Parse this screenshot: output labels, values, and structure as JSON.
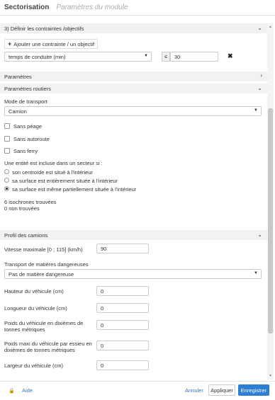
{
  "header": {
    "title": "Sectorisation",
    "subtitle": "Paramètres du module"
  },
  "constraints": {
    "section_title": "3) Définir les contraintes /objectifs",
    "add_button": "Ajouter une contrainte / un objectif",
    "constraint_select": "temps de conduite (min)",
    "operator": "≤",
    "value": "30"
  },
  "parametres": {
    "section_title": "Paramètres"
  },
  "routiers": {
    "section_title": "Paramètres routiers",
    "transport_mode_label": "Mode de transport",
    "transport_mode_value": "Camion",
    "checkboxes": [
      "Sans péage",
      "Sans autoroute",
      "Sans ferry"
    ],
    "inclusion_label": "Une entité est incluse dans un secteur si :",
    "radios": [
      "son centroïde est situé à l'intérieur",
      "sa surface est entièrement située à l'intérieur",
      "sa surface est même partiellement située à l'intérieur"
    ],
    "selected_radio": 2,
    "isochrones_found": "6 isochrones trouvées",
    "not_found": "0 non trouvées"
  },
  "camions": {
    "section_title": "Profil des camions",
    "speed_label": "Vitesse maximale [0 ; 115] (km/h)",
    "speed_value": "90",
    "dangerous_label": "Transport de matières dangereuses",
    "dangerous_value": "Pas de matière dangereuse",
    "fields": [
      {
        "label": "Hauteur du véhicule (cm)",
        "value": "0"
      },
      {
        "label": "Longueur du véhicule (cm)",
        "value": "0"
      },
      {
        "label": "Poids du véhicule en dixièmes de tonnes métriques",
        "value": "0"
      },
      {
        "label": "Poids maxi du véhicule par essieu en dixièmes de tonnes métriques",
        "value": "0"
      },
      {
        "label": "Largeur du véhicule (cm)",
        "value": "0"
      }
    ]
  },
  "footer": {
    "help": "Aide",
    "cancel": "Annuler",
    "apply": "Appliquer",
    "save": "Enregistrer"
  },
  "colors": {
    "primary": "#2d7fd2",
    "link": "#3b73b9"
  }
}
